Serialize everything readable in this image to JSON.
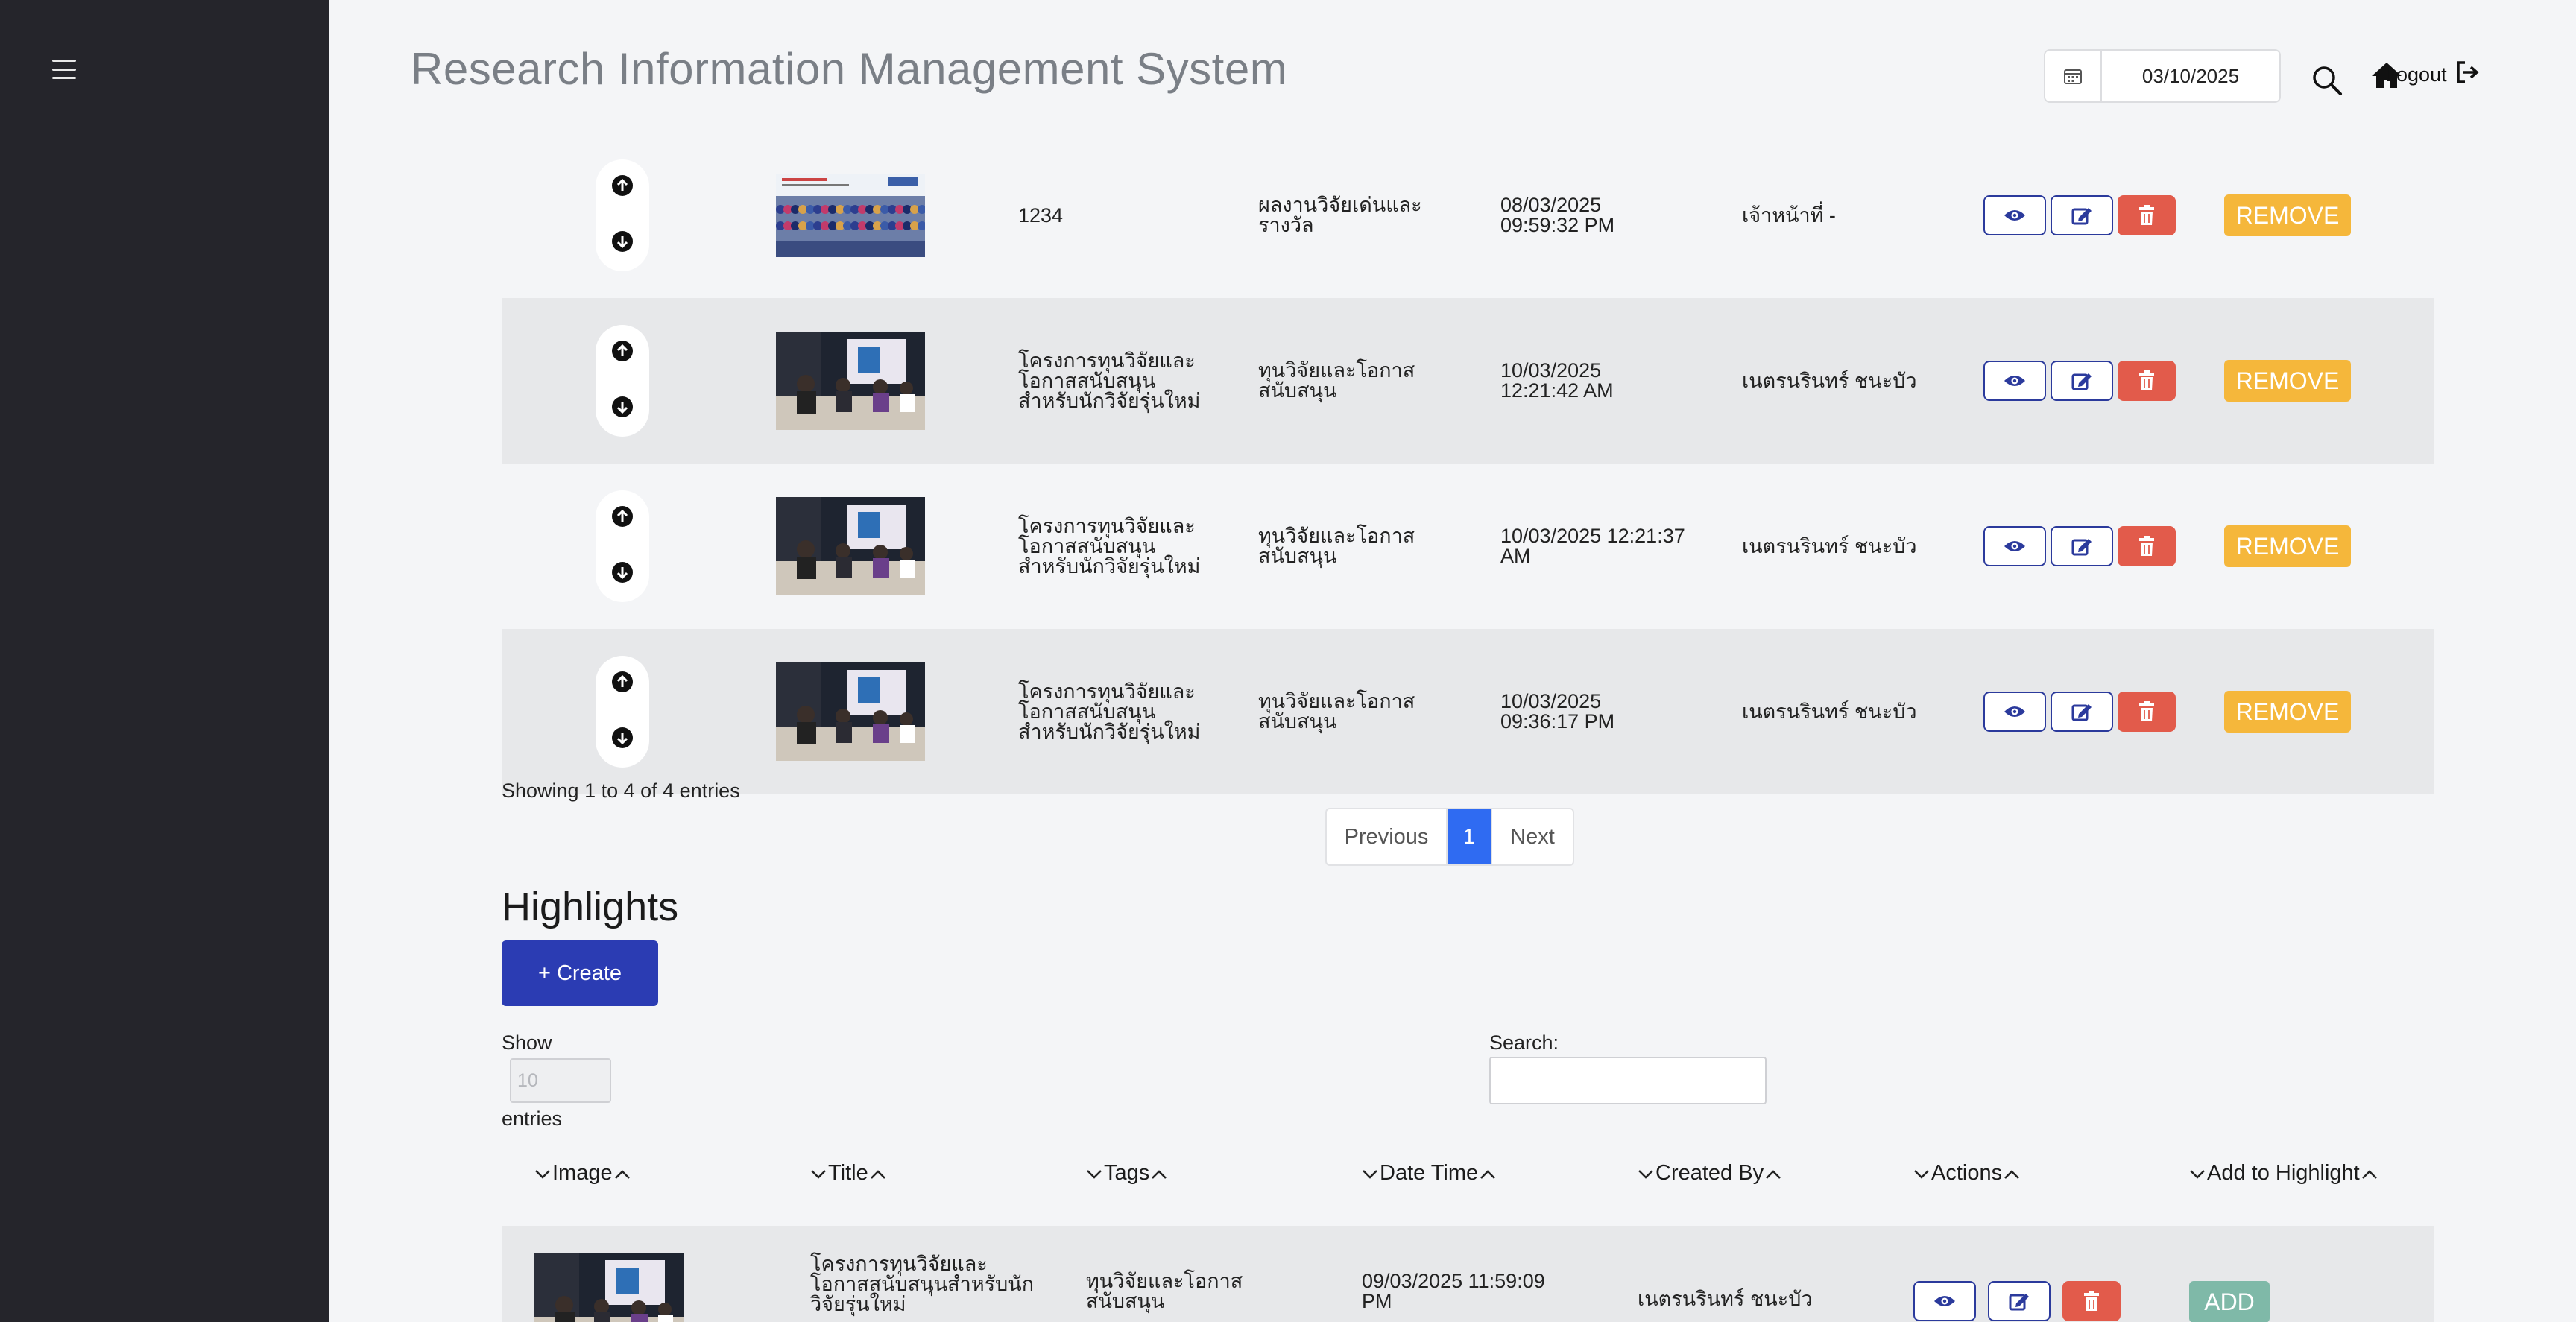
{
  "header": {
    "title": "Research Information Management System",
    "date_value": "03/10/2025",
    "logout_label": "Logout"
  },
  "table1": {
    "rows": [
      {
        "title": "1234",
        "tags": "ผลงานวิจัยเด่นและ\nรางวัล",
        "datetime": "08/03/2025\n09:59:32 PM",
        "created_by": "เจ้าหน้าที่ -",
        "remove_label": "REMOVE"
      },
      {
        "title": "โครงการทุนวิจัยและ\nโอกาสสนับสนุน\nสำหรับนักวิจัยรุ่นใหม่",
        "tags": "ทุนวิจัยและโอกาส\nสนับสนุน",
        "datetime": "10/03/2025\n12:21:42 AM",
        "created_by": "เนตรนรินทร์ ชนะบัว",
        "remove_label": "REMOVE"
      },
      {
        "title": "โครงการทุนวิจัยและ\nโอกาสสนับสนุน\nสำหรับนักวิจัยรุ่นใหม่",
        "tags": "ทุนวิจัยและโอกาส\nสนับสนุน",
        "datetime": "10/03/2025 12:21:37\nAM",
        "created_by": "เนตรนรินทร์ ชนะบัว",
        "remove_label": "REMOVE"
      },
      {
        "title": "โครงการทุนวิจัยและ\nโอกาสสนับสนุน\nสำหรับนักวิจัยรุ่นใหม่",
        "tags": "ทุนวิจัยและโอกาส\nสนับสนุน",
        "datetime": "10/03/2025\n09:36:17 PM",
        "created_by": "เนตรนรินทร์ ชนะบัว",
        "remove_label": "REMOVE"
      }
    ],
    "showing_text": "Showing 1 to 4 of 4 entries",
    "pagination": {
      "previous": "Previous",
      "current": "1",
      "next": "Next"
    }
  },
  "highlights": {
    "title": "Highlights",
    "create_label": "+ Create",
    "show_label": "Show",
    "show_value": "10",
    "entries_label": "entries",
    "search_label": "Search:",
    "columns": [
      "Image",
      "Title",
      "Tags",
      "Date Time",
      "Created By",
      "Actions",
      "Add to Highlight"
    ],
    "rows": [
      {
        "title": "โครงการทุนวิจัยและ\nโอกาสสนับสนุนสำหรับนัก\nวิจัยรุ่นใหม่",
        "tags": "ทุนวิจัยและโอกาส\nสนับสนุน",
        "datetime": "09/03/2025 11:59:09\nPM",
        "created_by": "เนตรนรินทร์ ชนะบัว",
        "add_label": "ADD"
      }
    ]
  },
  "colors": {
    "sidebar": "#25252b",
    "primary": "#2b3cb3",
    "danger": "#e25b4b",
    "warning": "#f5b73b",
    "success_muted": "#7fb9a8",
    "page_active": "#2f6bf2"
  },
  "icons": [
    "menu-icon",
    "calendar-icon",
    "search-icon",
    "home-icon",
    "logout-icon",
    "arrow-up-icon",
    "arrow-down-icon",
    "eye-icon",
    "edit-icon",
    "trash-icon",
    "chevron-down-icon",
    "chevron-up-icon"
  ]
}
